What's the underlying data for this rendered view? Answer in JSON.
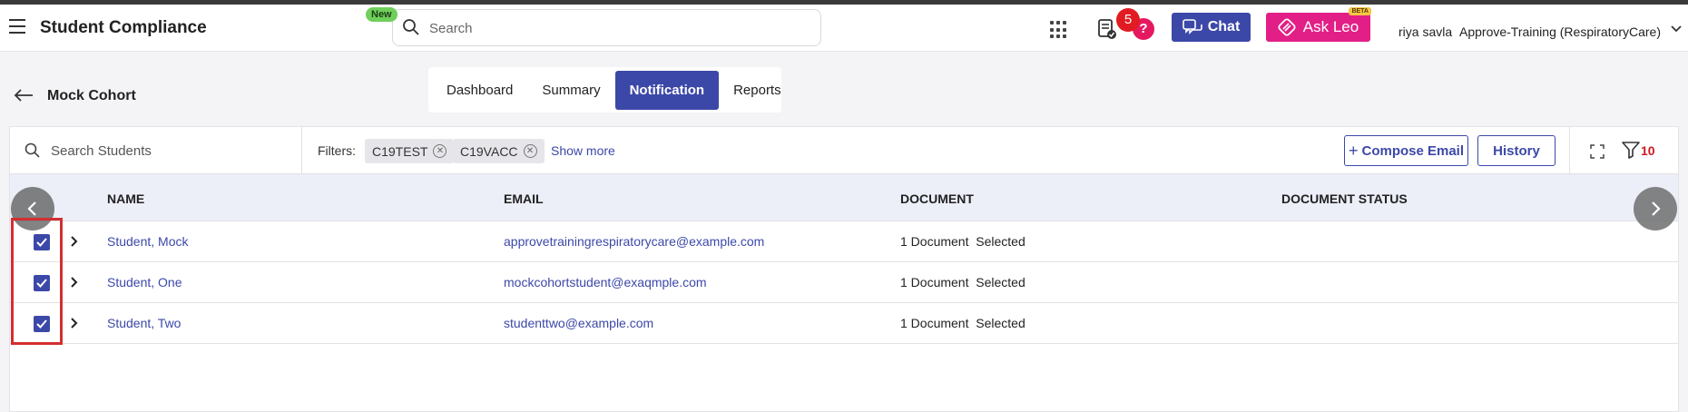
{
  "header": {
    "title": "Student Compliance",
    "new_badge": "New",
    "search_placeholder": "Search",
    "notification_count": "5",
    "help_label": "?",
    "chat_label": "Chat",
    "ask_leo_label": "Ask Leo",
    "beta_label": "BETA",
    "user_name": "riya savla",
    "org_name": "Approve-Training (RespiratoryCare)"
  },
  "page": {
    "cohort_title": "Mock Cohort",
    "tabs": [
      {
        "label": "Dashboard",
        "active": false
      },
      {
        "label": "Summary",
        "active": false
      },
      {
        "label": "Notification",
        "active": true
      },
      {
        "label": "Reports",
        "active": false
      }
    ]
  },
  "toolbar": {
    "search_placeholder": "Search Students",
    "filters_label": "Filters:",
    "chips": [
      "C19TEST",
      "C19VACC"
    ],
    "show_more": "Show more",
    "compose_label": "Compose Email",
    "history_label": "History",
    "filter_count": "10"
  },
  "table": {
    "columns": [
      "NAME",
      "EMAIL",
      "DOCUMENT",
      "DOCUMENT STATUS"
    ],
    "rows": [
      {
        "name": "Student, Mock",
        "email": "approvetrainingrespiratorycare@example.com",
        "document": "1 Document  Selected",
        "status": "",
        "checked": true
      },
      {
        "name": "Student, One",
        "email": "mockcohortstudent@exaqmple.com",
        "document": "1 Document  Selected",
        "status": "",
        "checked": true
      },
      {
        "name": "Student, Two",
        "email": "studenttwo@example.com",
        "document": "1 Document  Selected",
        "status": "",
        "checked": true
      }
    ]
  },
  "colors": {
    "primary": "#3c48a8",
    "accent_pink": "#e21f86",
    "alert_red": "#e11b22",
    "highlight_box": "#d32f2f"
  },
  "icons": [
    "hamburger-icon",
    "search-icon",
    "grid-icon",
    "document-check-icon",
    "chat-icon",
    "leo-logo-icon",
    "chevron-down-icon",
    "back-arrow-icon",
    "close-circle-icon",
    "plus-icon",
    "expand-icon",
    "filter-icon",
    "chevron-right-icon",
    "checkbox-checked-icon",
    "arrow-left-icon",
    "arrow-right-icon"
  ]
}
